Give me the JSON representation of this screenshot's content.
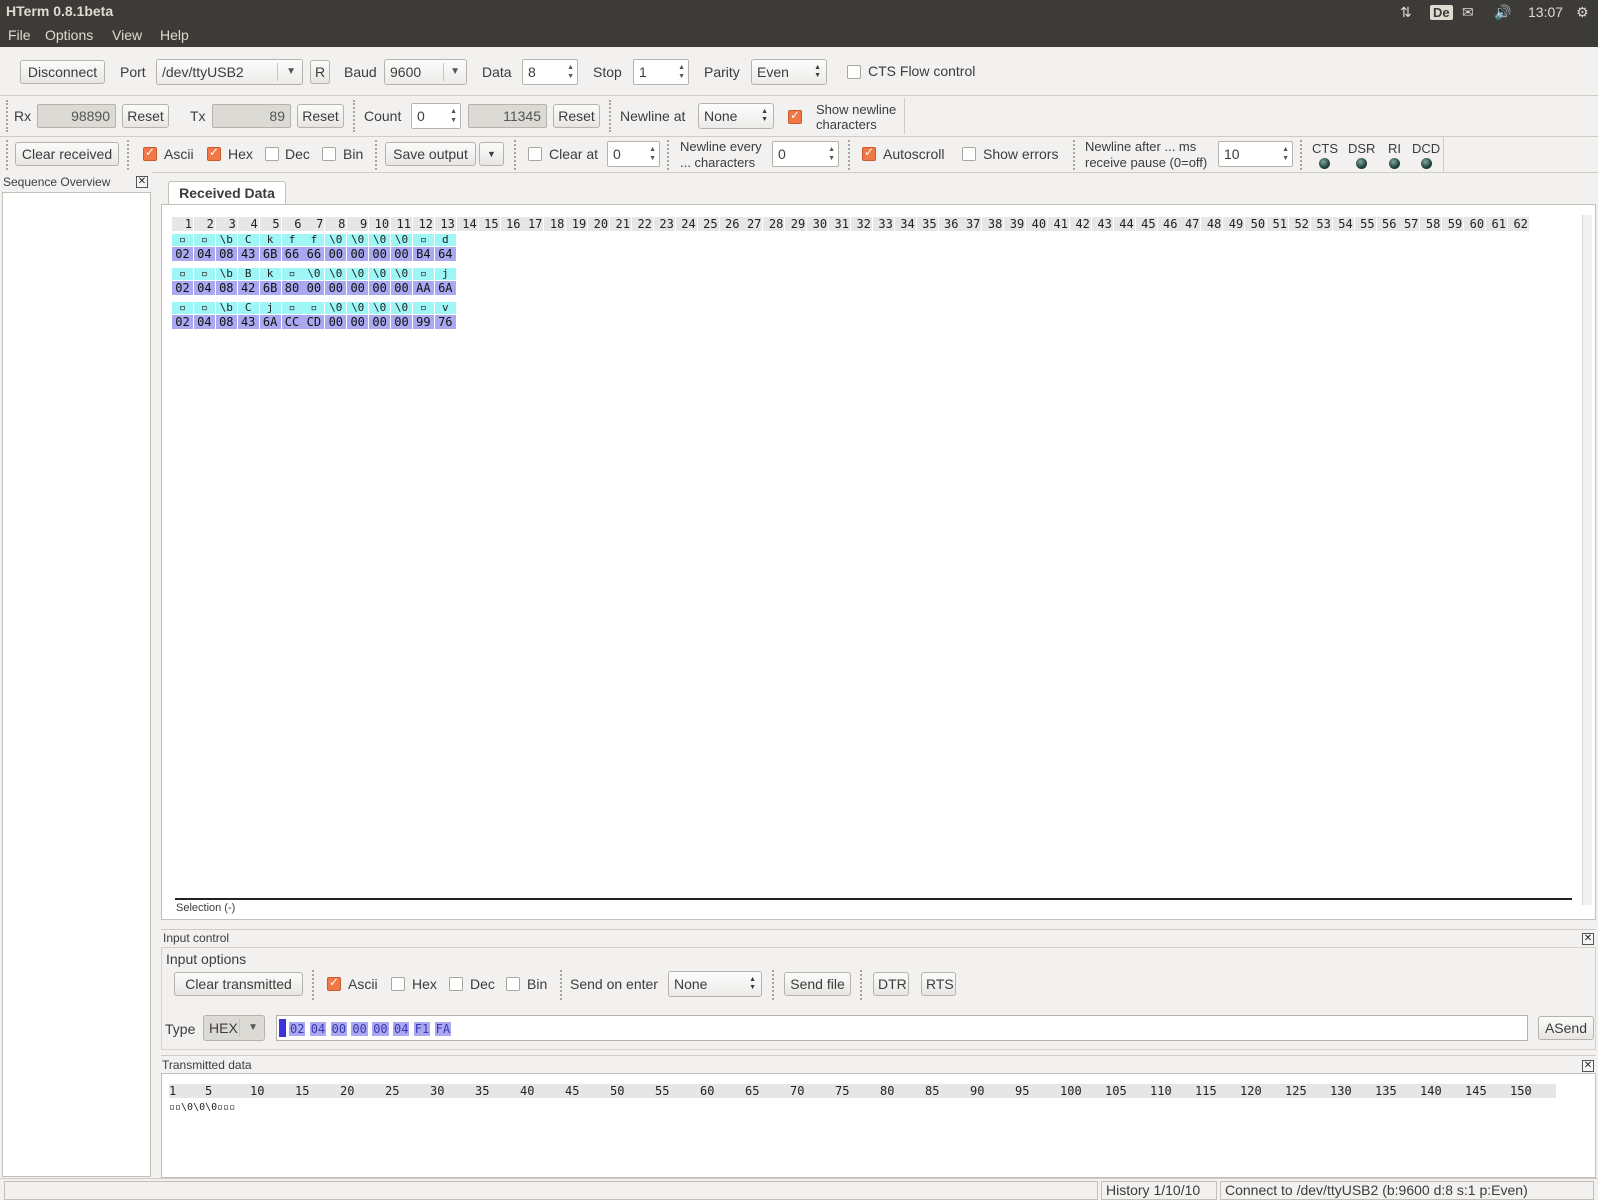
{
  "window": {
    "title": "HTerm 0.8.1beta",
    "clock": "13:07",
    "keyboard_layout": "De",
    "indicator_icons": [
      "network-arrows-icon",
      "mail-icon",
      "volume-icon",
      "gear-icon"
    ]
  },
  "menu": [
    "File",
    "Options",
    "View",
    "Help"
  ],
  "connection": {
    "disconnect_label": "Disconnect",
    "port_label": "Port",
    "port_value": "/dev/ttyUSB2",
    "refresh_label": "R",
    "baud_label": "Baud",
    "baud_value": "9600",
    "data_label": "Data",
    "data_value": "8",
    "stop_label": "Stop",
    "stop_value": "1",
    "parity_label": "Parity",
    "parity_value": "Even",
    "cts_flow_label": "CTS Flow control",
    "cts_flow_checked": false
  },
  "counters": {
    "rx_label": "Rx",
    "rx_value": "98890",
    "rx_reset_label": "Reset",
    "tx_label": "Tx",
    "tx_value": "89",
    "tx_reset_label": "Reset",
    "count_label": "Count",
    "count_value": "0",
    "count_total": "11345",
    "count_reset_label": "Reset",
    "newline_at_label": "Newline at",
    "newline_at_value": "None",
    "show_newline_label_1": "Show newline",
    "show_newline_label_2": "characters",
    "show_newline_checked": true
  },
  "display": {
    "clear_received_label": "Clear received",
    "ascii_label": "Ascii",
    "ascii_checked": true,
    "hex_label": "Hex",
    "hex_checked": true,
    "dec_label": "Dec",
    "dec_checked": false,
    "bin_label": "Bin",
    "bin_checked": false,
    "save_output_label": "Save output",
    "clear_at_label": "Clear at",
    "clear_at_checked": false,
    "clear_at_value": "0",
    "newline_every_label_1": "Newline every",
    "newline_every_label_2": "... characters",
    "newline_every_value": "0",
    "autoscroll_label": "Autoscroll",
    "autoscroll_checked": true,
    "show_errors_label": "Show errors",
    "show_errors_checked": false,
    "newline_after_label_1": "Newline after ... ms",
    "newline_after_label_2": "receive pause (0=off)",
    "newline_after_value": "10",
    "signals": [
      "CTS",
      "DSR",
      "RI",
      "DCD"
    ]
  },
  "sequence_overview": {
    "title": "Sequence Overview"
  },
  "received": {
    "tab_label": "Received Data",
    "ruler": [
      "1",
      "2",
      "3",
      "4",
      "5",
      "6",
      "7",
      "8",
      "9",
      "10",
      "11",
      "12",
      "13",
      "14",
      "15",
      "16",
      "17",
      "18",
      "19",
      "20",
      "21",
      "22",
      "23",
      "24",
      "25",
      "26",
      "27",
      "28",
      "29",
      "30",
      "31",
      "32",
      "33",
      "34",
      "35",
      "36",
      "37",
      "38",
      "39",
      "40",
      "41",
      "42",
      "43",
      "44",
      "45",
      "46",
      "47",
      "48",
      "49",
      "50",
      "51",
      "52",
      "53",
      "54",
      "55",
      "56",
      "57",
      "58",
      "59",
      "60",
      "61",
      "62"
    ],
    "rows": [
      {
        "ascii": [
          "▫",
          "▫",
          "\\b",
          "C",
          "k",
          "f",
          "f",
          "\\0",
          "\\0",
          "\\0",
          "\\0",
          "▫",
          "d"
        ],
        "hex": [
          "02",
          "04",
          "08",
          "43",
          "6B",
          "66",
          "66",
          "00",
          "00",
          "00",
          "00",
          "B4",
          "64"
        ]
      },
      {
        "ascii": [
          "▫",
          "▫",
          "\\b",
          "B",
          "k",
          "▫",
          "\\0",
          "\\0",
          "\\0",
          "\\0",
          "\\0",
          "▫",
          "j"
        ],
        "hex": [
          "02",
          "04",
          "08",
          "42",
          "6B",
          "80",
          "00",
          "00",
          "00",
          "00",
          "00",
          "AA",
          "6A"
        ]
      },
      {
        "ascii": [
          "▫",
          "▫",
          "\\b",
          "C",
          "j",
          "▫",
          "▫",
          "\\0",
          "\\0",
          "\\0",
          "\\0",
          "▫",
          "v"
        ],
        "hex": [
          "02",
          "04",
          "08",
          "43",
          "6A",
          "CC",
          "CD",
          "00",
          "00",
          "00",
          "00",
          "99",
          "76"
        ]
      }
    ],
    "selection_label": "Selection (-)"
  },
  "input_control": {
    "title": "Input control",
    "options_title": "Input options",
    "clear_transmitted_label": "Clear transmitted",
    "ascii_label": "Ascii",
    "ascii_checked": true,
    "hex_label": "Hex",
    "hex_checked": false,
    "dec_label": "Dec",
    "dec_checked": false,
    "bin_label": "Bin",
    "bin_checked": false,
    "send_on_enter_label": "Send on enter",
    "send_on_enter_value": "None",
    "send_file_label": "Send file",
    "dtr_label": "DTR",
    "rts_label": "RTS",
    "type_label": "Type",
    "type_value": "HEX",
    "input_bytes": [
      "02",
      "04",
      "00",
      "00",
      "00",
      "04",
      "F1",
      "FA"
    ],
    "asend_label": "ASend"
  },
  "transmitted": {
    "title": "Transmitted data",
    "ruler": [
      "1",
      "5",
      "10",
      "15",
      "20",
      "25",
      "30",
      "35",
      "40",
      "45",
      "50",
      "55",
      "60",
      "65",
      "70",
      "75",
      "80",
      "85",
      "90",
      "95",
      "100",
      "105",
      "110",
      "115",
      "120",
      "125",
      "130",
      "135",
      "140",
      "145",
      "150"
    ],
    "content": "▫▫\\0\\0\\0▫▫▫"
  },
  "status": {
    "history": "History 1/10/10",
    "connection": "Connect to /dev/ttyUSB2 (b:9600 d:8 s:1 p:Even)"
  }
}
